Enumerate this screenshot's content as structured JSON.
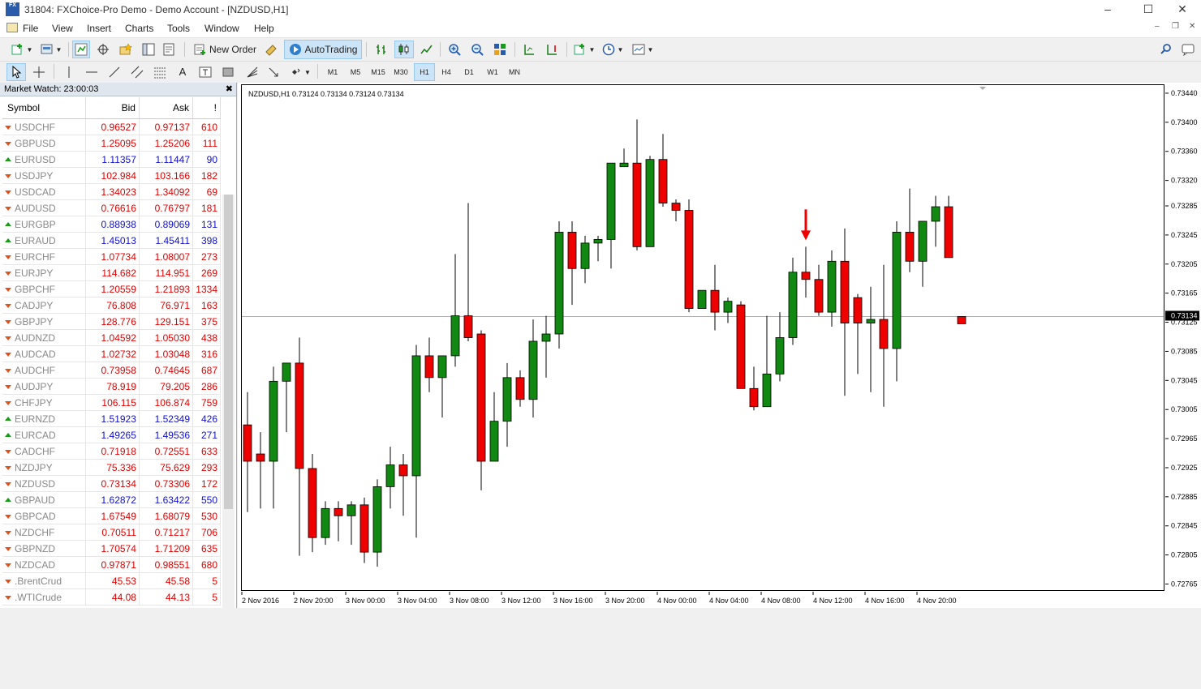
{
  "window": {
    "title": "31804: FXChoice-Pro Demo - Demo Account - [NZDUSD,H1]",
    "icon_text": "FX"
  },
  "menu": [
    "File",
    "View",
    "Insert",
    "Charts",
    "Tools",
    "Window",
    "Help"
  ],
  "toolbar": {
    "new_order": "New Order",
    "auto_trading": "AutoTrading",
    "timeframes": [
      "M1",
      "M5",
      "M15",
      "M30",
      "H1",
      "H4",
      "D1",
      "W1",
      "MN"
    ],
    "active_timeframe": "H1"
  },
  "market_watch": {
    "title": "Market Watch: 23:00:03",
    "columns": [
      "Symbol",
      "Bid",
      "Ask",
      "!"
    ],
    "rows": [
      {
        "symbol": "USDCHF",
        "bid": "0.96527",
        "ask": "0.97137",
        "spread": "610",
        "dir": "down",
        "color": "red"
      },
      {
        "symbol": "GBPUSD",
        "bid": "1.25095",
        "ask": "1.25206",
        "spread": "111",
        "dir": "down",
        "color": "red"
      },
      {
        "symbol": "EURUSD",
        "bid": "1.11357",
        "ask": "1.11447",
        "spread": "90",
        "dir": "up",
        "color": "blue"
      },
      {
        "symbol": "USDJPY",
        "bid": "102.984",
        "ask": "103.166",
        "spread": "182",
        "dir": "down",
        "color": "red"
      },
      {
        "symbol": "USDCAD",
        "bid": "1.34023",
        "ask": "1.34092",
        "spread": "69",
        "dir": "down",
        "color": "red"
      },
      {
        "symbol": "AUDUSD",
        "bid": "0.76616",
        "ask": "0.76797",
        "spread": "181",
        "dir": "down",
        "color": "red"
      },
      {
        "symbol": "EURGBP",
        "bid": "0.88938",
        "ask": "0.89069",
        "spread": "131",
        "dir": "up",
        "color": "blue"
      },
      {
        "symbol": "EURAUD",
        "bid": "1.45013",
        "ask": "1.45411",
        "spread": "398",
        "dir": "up",
        "color": "blue"
      },
      {
        "symbol": "EURCHF",
        "bid": "1.07734",
        "ask": "1.08007",
        "spread": "273",
        "dir": "down",
        "color": "red"
      },
      {
        "symbol": "EURJPY",
        "bid": "114.682",
        "ask": "114.951",
        "spread": "269",
        "dir": "down",
        "color": "red"
      },
      {
        "symbol": "GBPCHF",
        "bid": "1.20559",
        "ask": "1.21893",
        "spread": "1334",
        "dir": "down",
        "color": "red"
      },
      {
        "symbol": "CADJPY",
        "bid": "76.808",
        "ask": "76.971",
        "spread": "163",
        "dir": "down",
        "color": "red"
      },
      {
        "symbol": "GBPJPY",
        "bid": "128.776",
        "ask": "129.151",
        "spread": "375",
        "dir": "down",
        "color": "red"
      },
      {
        "symbol": "AUDNZD",
        "bid": "1.04592",
        "ask": "1.05030",
        "spread": "438",
        "dir": "down",
        "color": "red"
      },
      {
        "symbol": "AUDCAD",
        "bid": "1.02732",
        "ask": "1.03048",
        "spread": "316",
        "dir": "down",
        "color": "red"
      },
      {
        "symbol": "AUDCHF",
        "bid": "0.73958",
        "ask": "0.74645",
        "spread": "687",
        "dir": "down",
        "color": "red"
      },
      {
        "symbol": "AUDJPY",
        "bid": "78.919",
        "ask": "79.205",
        "spread": "286",
        "dir": "down",
        "color": "red"
      },
      {
        "symbol": "CHFJPY",
        "bid": "106.115",
        "ask": "106.874",
        "spread": "759",
        "dir": "down",
        "color": "red"
      },
      {
        "symbol": "EURNZD",
        "bid": "1.51923",
        "ask": "1.52349",
        "spread": "426",
        "dir": "up",
        "color": "blue"
      },
      {
        "symbol": "EURCAD",
        "bid": "1.49265",
        "ask": "1.49536",
        "spread": "271",
        "dir": "up",
        "color": "blue"
      },
      {
        "symbol": "CADCHF",
        "bid": "0.71918",
        "ask": "0.72551",
        "spread": "633",
        "dir": "down",
        "color": "red"
      },
      {
        "symbol": "NZDJPY",
        "bid": "75.336",
        "ask": "75.629",
        "spread": "293",
        "dir": "down",
        "color": "red"
      },
      {
        "symbol": "NZDUSD",
        "bid": "0.73134",
        "ask": "0.73306",
        "spread": "172",
        "dir": "down",
        "color": "red"
      },
      {
        "symbol": "GBPAUD",
        "bid": "1.62872",
        "ask": "1.63422",
        "spread": "550",
        "dir": "up",
        "color": "blue"
      },
      {
        "symbol": "GBPCAD",
        "bid": "1.67549",
        "ask": "1.68079",
        "spread": "530",
        "dir": "down",
        "color": "red"
      },
      {
        "symbol": "NZDCHF",
        "bid": "0.70511",
        "ask": "0.71217",
        "spread": "706",
        "dir": "down",
        "color": "red"
      },
      {
        "symbol": "GBPNZD",
        "bid": "1.70574",
        "ask": "1.71209",
        "spread": "635",
        "dir": "down",
        "color": "red"
      },
      {
        "symbol": "NZDCAD",
        "bid": "0.97871",
        "ask": "0.98551",
        "spread": "680",
        "dir": "down",
        "color": "red"
      },
      {
        "symbol": ".BrentCrud",
        "bid": "45.53",
        "ask": "45.58",
        "spread": "5",
        "dir": "down",
        "color": "red"
      },
      {
        "symbol": ".WTICrude",
        "bid": "44.08",
        "ask": "44.13",
        "spread": "5",
        "dir": "down",
        "color": "red"
      }
    ]
  },
  "chart_data": {
    "type": "candlestick",
    "title": "NZDUSD,H1  0.73124 0.73134 0.73124 0.73134",
    "symbol": "NZDUSD",
    "timeframe": "H1",
    "current_price": "0.73134",
    "ylim": [
      0.7276,
      0.7345
    ],
    "y_ticks": [
      "0.73440",
      "0.73400",
      "0.73360",
      "0.73320",
      "0.73285",
      "0.73245",
      "0.73205",
      "0.73165",
      "0.73125",
      "0.73085",
      "0.73045",
      "0.73005",
      "0.72965",
      "0.72925",
      "0.72885",
      "0.72845",
      "0.72805",
      "0.72765"
    ],
    "x_labels": [
      "2 Nov 2016",
      "2 Nov 20:00",
      "3 Nov 00:00",
      "3 Nov 04:00",
      "3 Nov 08:00",
      "3 Nov 12:00",
      "3 Nov 16:00",
      "3 Nov 20:00",
      "4 Nov 00:00",
      "4 Nov 04:00",
      "4 Nov 08:00",
      "4 Nov 12:00",
      "4 Nov 16:00",
      "4 Nov 20:00"
    ],
    "bull_color": "#118811",
    "bear_color": "#ee0000",
    "candles": [
      {
        "o": 0.72985,
        "h": 0.7303,
        "l": 0.72865,
        "c": 0.72935
      },
      {
        "o": 0.72945,
        "h": 0.72975,
        "l": 0.7287,
        "c": 0.72935
      },
      {
        "o": 0.72935,
        "h": 0.73065,
        "l": 0.7287,
        "c": 0.73045
      },
      {
        "o": 0.73045,
        "h": 0.7307,
        "l": 0.72975,
        "c": 0.7307
      },
      {
        "o": 0.7307,
        "h": 0.73105,
        "l": 0.72805,
        "c": 0.72925
      },
      {
        "o": 0.72925,
        "h": 0.72945,
        "l": 0.7281,
        "c": 0.7283
      },
      {
        "o": 0.7283,
        "h": 0.7288,
        "l": 0.7282,
        "c": 0.7287
      },
      {
        "o": 0.7287,
        "h": 0.7288,
        "l": 0.72825,
        "c": 0.7286
      },
      {
        "o": 0.7286,
        "h": 0.7288,
        "l": 0.7282,
        "c": 0.72875
      },
      {
        "o": 0.72875,
        "h": 0.72885,
        "l": 0.72795,
        "c": 0.7281
      },
      {
        "o": 0.7281,
        "h": 0.7291,
        "l": 0.7279,
        "c": 0.729
      },
      {
        "o": 0.729,
        "h": 0.72955,
        "l": 0.7287,
        "c": 0.7293
      },
      {
        "o": 0.7293,
        "h": 0.72945,
        "l": 0.7286,
        "c": 0.72915
      },
      {
        "o": 0.72915,
        "h": 0.73095,
        "l": 0.7283,
        "c": 0.7308
      },
      {
        "o": 0.7308,
        "h": 0.73105,
        "l": 0.7303,
        "c": 0.7305
      },
      {
        "o": 0.7305,
        "h": 0.7308,
        "l": 0.72995,
        "c": 0.7308
      },
      {
        "o": 0.7308,
        "h": 0.7322,
        "l": 0.73065,
        "c": 0.73135
      },
      {
        "o": 0.73135,
        "h": 0.7329,
        "l": 0.731,
        "c": 0.73105
      },
      {
        "o": 0.7311,
        "h": 0.73115,
        "l": 0.72895,
        "c": 0.72935
      },
      {
        "o": 0.72935,
        "h": 0.7303,
        "l": 0.72935,
        "c": 0.7299
      },
      {
        "o": 0.7299,
        "h": 0.7307,
        "l": 0.72955,
        "c": 0.7305
      },
      {
        "o": 0.7305,
        "h": 0.7306,
        "l": 0.7301,
        "c": 0.7302
      },
      {
        "o": 0.7302,
        "h": 0.7313,
        "l": 0.72995,
        "c": 0.731
      },
      {
        "o": 0.731,
        "h": 0.73135,
        "l": 0.7305,
        "c": 0.7311
      },
      {
        "o": 0.7311,
        "h": 0.73265,
        "l": 0.7309,
        "c": 0.7325
      },
      {
        "o": 0.7325,
        "h": 0.73265,
        "l": 0.7315,
        "c": 0.732
      },
      {
        "o": 0.732,
        "h": 0.73245,
        "l": 0.7318,
        "c": 0.73235
      },
      {
        "o": 0.73235,
        "h": 0.73245,
        "l": 0.7321,
        "c": 0.7324
      },
      {
        "o": 0.7324,
        "h": 0.73345,
        "l": 0.732,
        "c": 0.73345
      },
      {
        "o": 0.7334,
        "h": 0.73365,
        "l": 0.7334,
        "c": 0.73345
      },
      {
        "o": 0.73345,
        "h": 0.73405,
        "l": 0.73225,
        "c": 0.7323
      },
      {
        "o": 0.7323,
        "h": 0.73355,
        "l": 0.7323,
        "c": 0.7335
      },
      {
        "o": 0.7335,
        "h": 0.73385,
        "l": 0.73285,
        "c": 0.7329
      },
      {
        "o": 0.7329,
        "h": 0.73295,
        "l": 0.73265,
        "c": 0.7328
      },
      {
        "o": 0.7328,
        "h": 0.73295,
        "l": 0.7314,
        "c": 0.73145
      },
      {
        "o": 0.73145,
        "h": 0.7317,
        "l": 0.73145,
        "c": 0.7317
      },
      {
        "o": 0.7317,
        "h": 0.73205,
        "l": 0.73115,
        "c": 0.7314
      },
      {
        "o": 0.7314,
        "h": 0.7316,
        "l": 0.73125,
        "c": 0.73155
      },
      {
        "o": 0.7315,
        "h": 0.73155,
        "l": 0.7305,
        "c": 0.73035
      },
      {
        "o": 0.73035,
        "h": 0.73065,
        "l": 0.73005,
        "c": 0.7301
      },
      {
        "o": 0.7301,
        "h": 0.73135,
        "l": 0.7301,
        "c": 0.73055
      },
      {
        "o": 0.73055,
        "h": 0.7314,
        "l": 0.73045,
        "c": 0.73105
      },
      {
        "o": 0.73105,
        "h": 0.73215,
        "l": 0.73095,
        "c": 0.73195
      },
      {
        "o": 0.73195,
        "h": 0.7323,
        "l": 0.7316,
        "c": 0.73185
      },
      {
        "o": 0.73185,
        "h": 0.73205,
        "l": 0.73135,
        "c": 0.7314
      },
      {
        "o": 0.7314,
        "h": 0.73225,
        "l": 0.7312,
        "c": 0.7321
      },
      {
        "o": 0.7321,
        "h": 0.73255,
        "l": 0.73025,
        "c": 0.73125
      },
      {
        "o": 0.7316,
        "h": 0.73165,
        "l": 0.73055,
        "c": 0.73125
      },
      {
        "o": 0.73125,
        "h": 0.73175,
        "l": 0.7303,
        "c": 0.7313
      },
      {
        "o": 0.7313,
        "h": 0.73205,
        "l": 0.7301,
        "c": 0.7309
      },
      {
        "o": 0.7309,
        "h": 0.73265,
        "l": 0.73045,
        "c": 0.7325
      },
      {
        "o": 0.7325,
        "h": 0.7331,
        "l": 0.73195,
        "c": 0.7321
      },
      {
        "o": 0.7321,
        "h": 0.73265,
        "l": 0.73175,
        "c": 0.73265
      },
      {
        "o": 0.73265,
        "h": 0.733,
        "l": 0.7323,
        "c": 0.73285
      },
      {
        "o": 0.73285,
        "h": 0.733,
        "l": 0.73215,
        "c": 0.73215
      },
      {
        "o": 0.73134,
        "h": 0.73134,
        "l": 0.73124,
        "c": 0.73124
      }
    ],
    "arrow_at_candle": 43
  }
}
